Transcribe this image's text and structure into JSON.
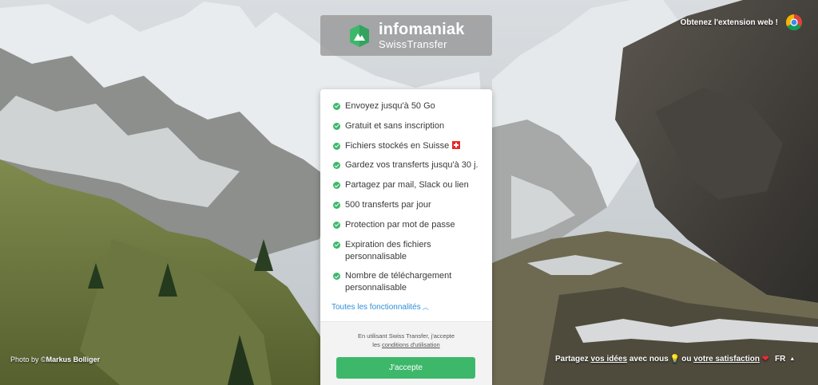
{
  "brand": {
    "name": "infomaniak",
    "product": "SwissTransfer"
  },
  "extension": {
    "label": "Obtenez l'extension web !",
    "icon": "chrome-icon"
  },
  "features": [
    {
      "label": "Envoyez jusqu'à 50 Go"
    },
    {
      "label": "Gratuit et sans inscription"
    },
    {
      "label": "Fichiers stockés en Suisse",
      "flag": "swiss-flag-icon"
    },
    {
      "label": "Gardez vos transferts jusqu'à 30 j."
    },
    {
      "label": "Partagez par mail, Slack ou lien"
    },
    {
      "label": "500 transferts par jour"
    },
    {
      "label": "Protection par mot de passe"
    },
    {
      "label": "Expiration des fichiers personnalisable"
    },
    {
      "label": "Nombre de téléchargement personnalisable"
    }
  ],
  "all_features_link": "Toutes les fonctionnalités",
  "consent": {
    "text_line1": "En utilisant Swiss Transfer, j'accepte",
    "text_prefix": "les",
    "terms_link": "conditions d'utilisation",
    "accept_button": "J'accepte"
  },
  "photo_credit": {
    "prefix": "Photo by ©",
    "author": "Markus Bolliger"
  },
  "feedback": {
    "prefix": "Partagez",
    "ideas_link": "vos idées",
    "middle": "avec nous",
    "or": "ou",
    "satisfaction_link": "votre satisfaction"
  },
  "language": "FR",
  "colors": {
    "accent_green": "#3db86a",
    "link_blue": "#2f8fd8",
    "swiss_red": "#e8282b"
  }
}
